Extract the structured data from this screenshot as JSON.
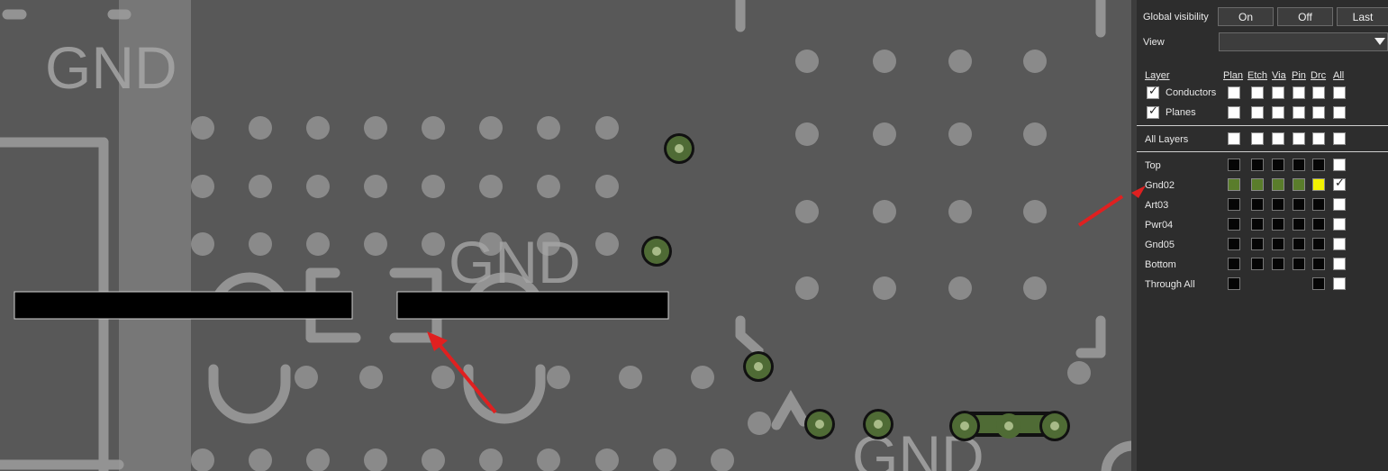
{
  "canvas": {
    "gnd_labels": [
      "GND",
      "GND",
      "GND"
    ],
    "colors": {
      "background": "#585858",
      "pad_grey": "#8a8a8a",
      "trace_grey": "#9d9d9d",
      "via_green": "#4f6b35",
      "via_center": "#a8bb88",
      "black_bar": "#000000",
      "annotation_arrow": "#e02020"
    }
  },
  "panel": {
    "global_visibility_label": "Global visibility",
    "buttons": {
      "on": "On",
      "off": "Off",
      "last": "Last"
    },
    "view_label": "View",
    "view_value": "",
    "columns": [
      "Layer",
      "Plan",
      "Etch",
      "Via",
      "Pin",
      "Drc",
      "All"
    ],
    "groups": [
      {
        "label": "Conductors",
        "checked": true
      },
      {
        "label": "Planes",
        "checked": true
      }
    ],
    "all_layers_label": "All Layers",
    "layers": [
      {
        "name": "Top",
        "states": [
          "dark",
          "dark",
          "dark",
          "dark",
          "dark",
          "white"
        ]
      },
      {
        "name": "Gnd02",
        "states": [
          "green",
          "green",
          "green",
          "green",
          "yellow",
          "white-check"
        ]
      },
      {
        "name": "Art03",
        "states": [
          "dark",
          "dark",
          "dark",
          "dark",
          "dark",
          "white"
        ]
      },
      {
        "name": "Pwr04",
        "states": [
          "dark",
          "dark",
          "dark",
          "dark",
          "dark",
          "white"
        ]
      },
      {
        "name": "Gnd05",
        "states": [
          "dark",
          "dark",
          "dark",
          "dark",
          "dark",
          "white"
        ]
      },
      {
        "name": "Bottom",
        "states": [
          "dark",
          "dark",
          "dark",
          "dark",
          "dark",
          "white"
        ]
      },
      {
        "name": "Through All",
        "states": [
          "dark",
          null,
          null,
          null,
          "dark",
          "white"
        ]
      }
    ]
  }
}
